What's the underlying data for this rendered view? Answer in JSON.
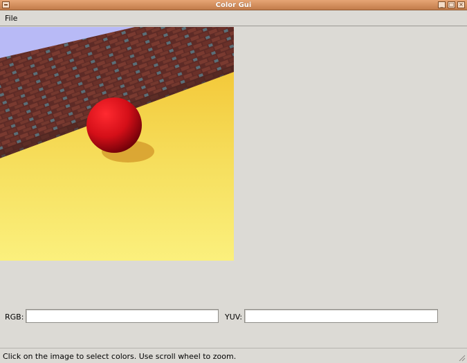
{
  "window": {
    "title": "Color Gui"
  },
  "menubar": {
    "file_label": "File"
  },
  "fields": {
    "rgb_label": "RGB:",
    "rgb_value": "",
    "yuv_label": "YUV:",
    "yuv_value": ""
  },
  "statusbar": {
    "text": "Click on the image to select colors. Use scroll wheel to zoom."
  },
  "colors": {
    "titlebar": "#d89060",
    "window_bg": "#dcdad5",
    "ball": "#d4101a",
    "floor": "#f3d64a",
    "sky": "#b8baf6",
    "brick": "#6a2e28"
  }
}
